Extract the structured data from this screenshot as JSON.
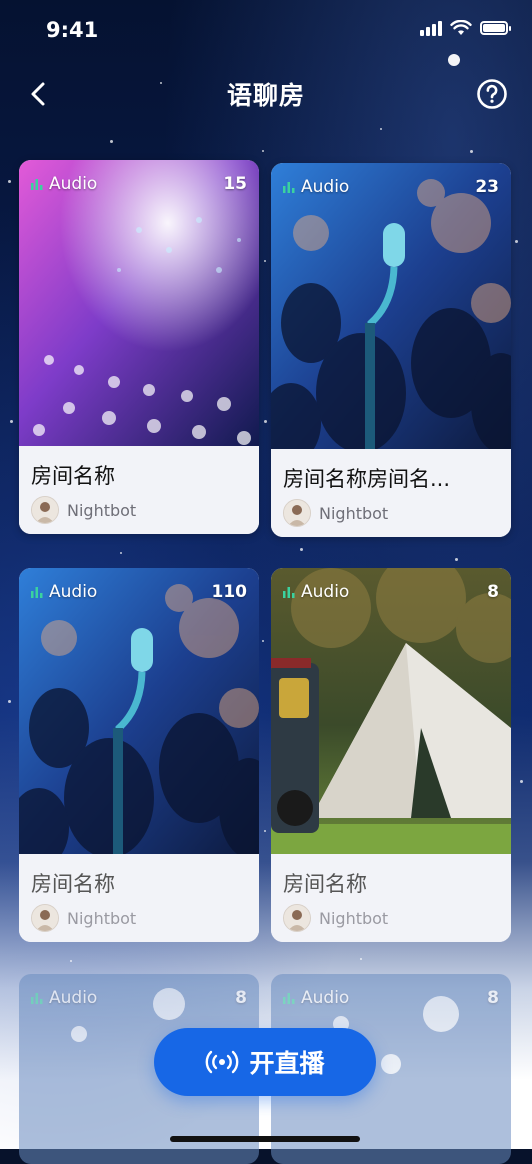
{
  "status_bar": {
    "time": "9:41",
    "icons": [
      "signal-icon",
      "wifi-icon",
      "battery-icon"
    ]
  },
  "nav": {
    "title": "语聊房",
    "back_icon": "back-chevron-icon",
    "help_icon": "help-circle-icon"
  },
  "rooms": [
    {
      "tag": "Audio",
      "count": "15",
      "title": "房间名称",
      "host": "Nightbot",
      "image": "concert-stage-lights"
    },
    {
      "tag": "Audio",
      "count": "23",
      "title": "房间名称房间名...",
      "host": "Nightbot",
      "image": "microphone-crowd"
    },
    {
      "tag": "Audio",
      "count": "110",
      "title": "房间名称",
      "host": "Nightbot",
      "image": "microphone-crowd"
    },
    {
      "tag": "Audio",
      "count": "8",
      "title": "房间名称",
      "host": "Nightbot",
      "image": "camping-tent"
    },
    {
      "tag": "Audio",
      "count": "8",
      "image": "stage-lights-faded"
    },
    {
      "tag": "Audio",
      "count": "8",
      "image": "stage-lights-faded"
    }
  ],
  "go_live": {
    "label": "开直播",
    "icon": "broadcast-icon"
  },
  "colors": {
    "accent": "#1767e6",
    "audio_tag_icon": "#3ad29f",
    "background": "#07122b"
  }
}
